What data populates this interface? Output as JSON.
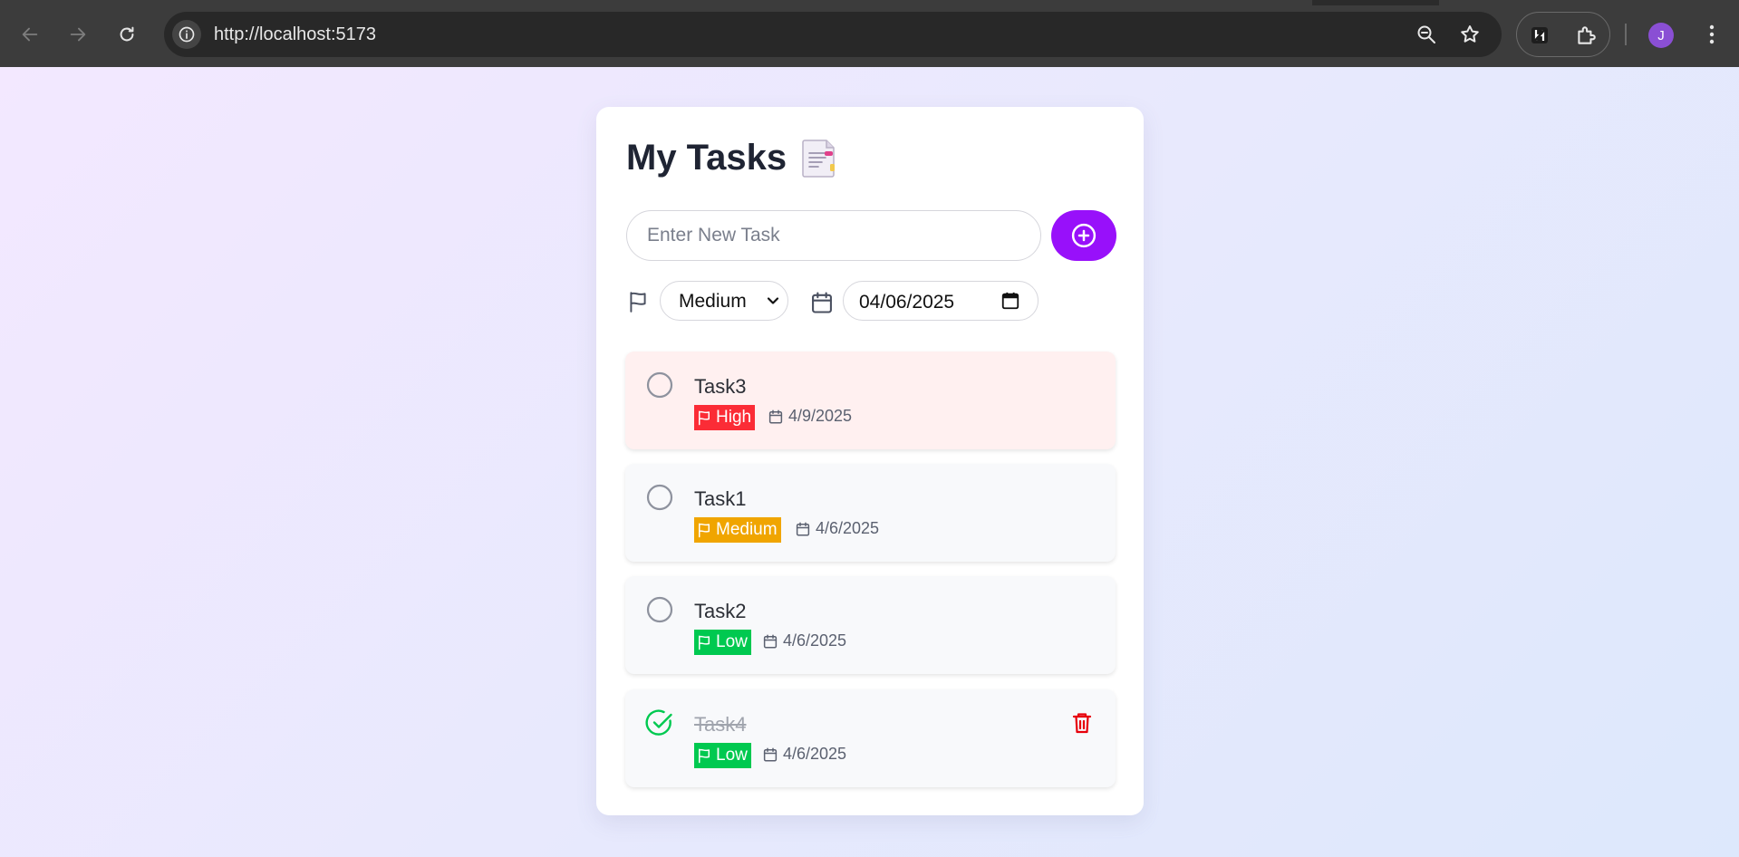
{
  "browser": {
    "url": "http://localhost:5173",
    "profile_initial": "J",
    "icons": {
      "back": "arrow-left-icon",
      "forward": "arrow-right-icon",
      "reload": "reload-icon",
      "site_info": "info-icon",
      "zoom": "zoom-out-icon",
      "bookmark": "star-icon",
      "extension_1": "extension-icon",
      "extensions": "puzzle-icon",
      "menu": "more-vertical-icon"
    }
  },
  "app": {
    "title": "My Tasks",
    "title_icon": "notepad-emoji",
    "new_task": {
      "placeholder": "Enter New Task",
      "value": "",
      "add_icon": "plus-circle-icon"
    },
    "priority": {
      "icon": "flag-icon",
      "selected": "Medium"
    },
    "due_date": {
      "icon": "calendar-icon",
      "value": "04/06/2025"
    },
    "colors": {
      "accent": "#9810fa",
      "high": "#fb2c36",
      "medium": "#f0a500",
      "low": "#00c950",
      "done_check": "#00c950",
      "delete": "#e7000b"
    },
    "tasks": [
      {
        "name": "Task3",
        "priority": "High",
        "date": "4/9/2025",
        "completed": false
      },
      {
        "name": "Task1",
        "priority": "Medium",
        "date": "4/6/2025",
        "completed": false
      },
      {
        "name": "Task2",
        "priority": "Low",
        "date": "4/6/2025",
        "completed": false
      },
      {
        "name": "Task4",
        "priority": "Low",
        "date": "4/6/2025",
        "completed": true,
        "delete_icon": "trash-icon"
      }
    ]
  }
}
